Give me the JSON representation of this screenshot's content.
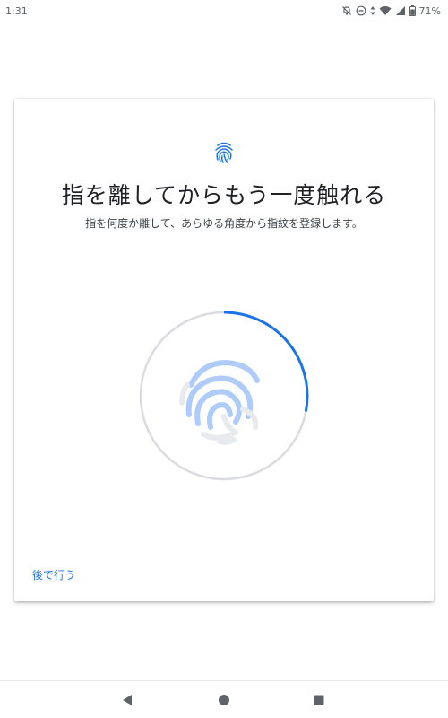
{
  "status_bar": {
    "time": "1:31",
    "battery": "71%",
    "icons": [
      "notifications-off-icon",
      "do-not-disturb-icon",
      "data-arrows-icon",
      "wifi-icon",
      "signal-icon",
      "battery-icon"
    ]
  },
  "enroll": {
    "header_icon": "fingerprint-icon",
    "title": "指を離してからもう一度触れる",
    "subtitle": "指を何度か離して、あらゆる角度から指紋を登録します。",
    "progress": 0.28,
    "later_label": "後で行う"
  },
  "nav_bar": {
    "icons": [
      "back-triangle-icon",
      "home-circle-icon",
      "recents-square-icon"
    ]
  },
  "colors": {
    "accent": "#1a73e8",
    "ring_track": "#dadce0",
    "fingerprint_light": "#aecbfa",
    "fingerprint_faded": "#e8eaed"
  }
}
